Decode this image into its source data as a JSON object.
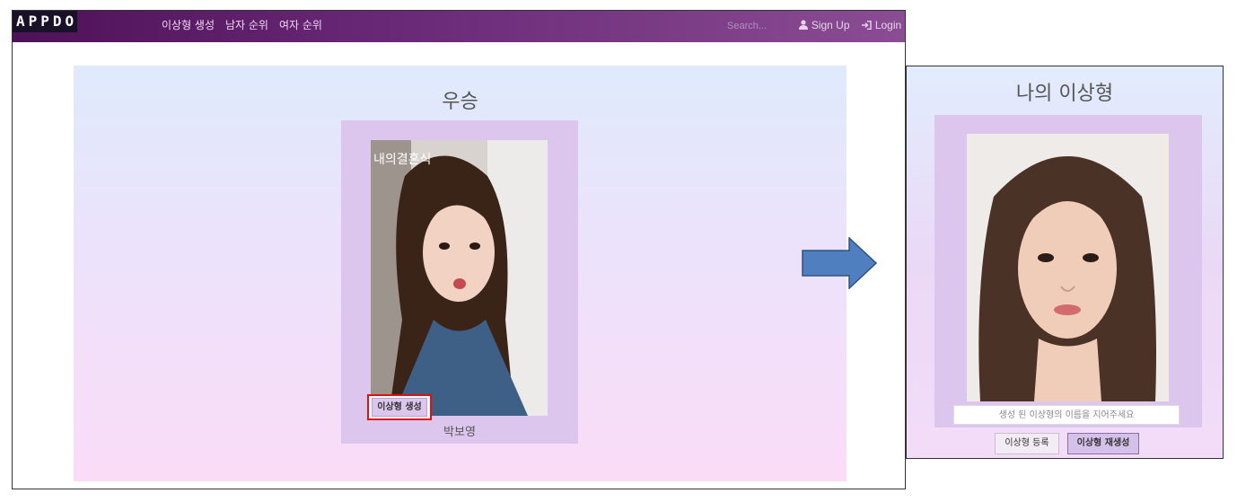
{
  "navbar": {
    "brand": "APPDO",
    "links": [
      "이상형 생성",
      "남자 순위",
      "여자 순위"
    ],
    "search_placeholder": "Search...",
    "sign_up": "Sign Up",
    "login": "Login"
  },
  "winner_panel": {
    "title": "우승",
    "photo_overlay_text": "내의결혼식",
    "name": "박보영",
    "generate_button": "이상형 생성"
  },
  "result_panel": {
    "title": "나의 이상형",
    "name_placeholder": "생성 된 이상형의 이름을 지어주세요",
    "register_button": "이상형 등록",
    "regenerate_button": "이상형 재생성"
  },
  "colors": {
    "navbar_start": "#4e1258",
    "navbar_end": "#8a4d93",
    "card_bg": "#ddc6ee",
    "highlight": "#e01010",
    "arrow_fill": "#4f7fbf"
  }
}
